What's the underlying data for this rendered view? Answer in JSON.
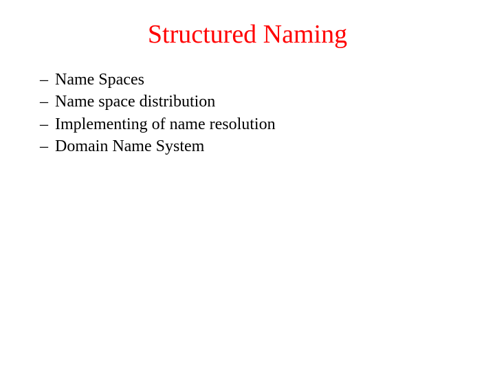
{
  "slide": {
    "title": "Structured Naming",
    "bullets": [
      {
        "marker": "–",
        "text": "Name Spaces"
      },
      {
        "marker": "–",
        "text": "Name space distribution"
      },
      {
        "marker": "–",
        "text": "Implementing of name resolution"
      },
      {
        "marker": "–",
        "text": "Domain Name System"
      }
    ]
  }
}
